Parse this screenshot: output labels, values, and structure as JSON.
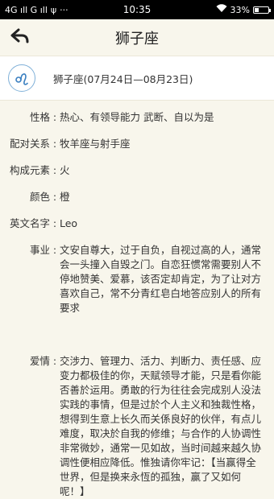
{
  "status": {
    "network": "4G ıll G ıll",
    "usb": "ψ",
    "dots": "···",
    "time": "10:35",
    "battery": "33%",
    "battery_level": 0.33
  },
  "header": {
    "title": "狮子座"
  },
  "info": {
    "text": "狮子座(07月24日—08月23日)"
  },
  "fields": [
    {
      "label": "性格",
      "value": "热心、有领导能力 武断、自以为是"
    },
    {
      "label": "配对关系",
      "value": "牧羊座与射手座"
    },
    {
      "label": "构成元素",
      "value": "火"
    },
    {
      "label": "颜色",
      "value": "橙"
    },
    {
      "label": "英文名字",
      "value": "Leo"
    },
    {
      "label": "事业",
      "value": "文安自尊大，过于自负，自视过高的人，通常会一头撞入自毁之门。自恋狂惯常需要别人不停地赞美、爱慕，该否定却肯定，为了让对方喜欢自己，常不分青红皂白地答应别人的所有要求"
    },
    {
      "label": "爱情",
      "value": "交涉力、管理力、活力、判断力、责任感、应变力都极佳的你，天赋领导才能，只是看你能否善於运用。勇敢的行为往往会完成别人没法实践的事情，但是过於个人主义和独裁性格，想得到生意上长久而关係良好的伙伴，有点儿难度，取决於自我的修维；与合作的人协调性非常微妙，通常一见如故，当时间越来越久协调性便相应降低。惟独请你牢记：【当赢得全世界，但是换来永恆的孤独，赢了又如何呢！】"
    }
  ]
}
